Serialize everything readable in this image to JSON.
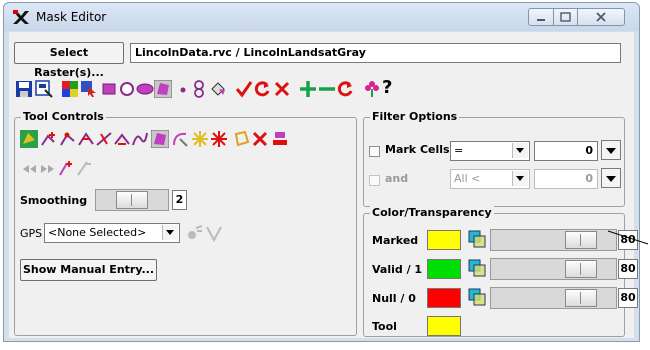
{
  "window": {
    "title": "Mask Editor"
  },
  "raster": {
    "select_label": "Select Raster(s)...",
    "path": "LincolnData.rvc / LincolnLandsatGray"
  },
  "toolbar": {
    "icons": [
      "save-icon",
      "save-as-icon",
      "multicolor-grid-icon",
      "pointer-select-icon",
      "rectangle-icon",
      "circle-icon",
      "ellipse-icon",
      "polygon-icon",
      "point-icon",
      "figure-eight-icon",
      "paint-bucket-icon",
      "check-icon",
      "refresh-icon",
      "cancel-icon",
      "add-icon",
      "subtract-icon",
      "cycle-icon",
      "flower-icon",
      "help-icon"
    ],
    "help_glyph": "?"
  },
  "tool_controls": {
    "title": "Tool Controls",
    "smoothing_label": "Smoothing",
    "smoothing_value": "2",
    "smoothing_level": 0.5,
    "gps_label": "GPS",
    "gps_value": "<None Selected>",
    "manual_entry_label": "Show Manual Entry..."
  },
  "filter_options": {
    "title": "Filter Options",
    "mark_cells_label": "Mark Cells",
    "operator": "=",
    "value": "0",
    "and_label": "and",
    "and_operator": "All <",
    "and_value": "0"
  },
  "color_transparency": {
    "title": "Color/Transparency",
    "rows": [
      {
        "label": "Marked",
        "color": "#ffff00",
        "value": "80",
        "level": 0.8
      },
      {
        "label": "Valid / 1",
        "color": "#00dd00",
        "value": "80",
        "level": 0.8
      },
      {
        "label": "Null / 0",
        "color": "#ff0000",
        "value": "80",
        "level": 0.8
      },
      {
        "label": "Tool",
        "color": "#ffff00"
      }
    ]
  }
}
